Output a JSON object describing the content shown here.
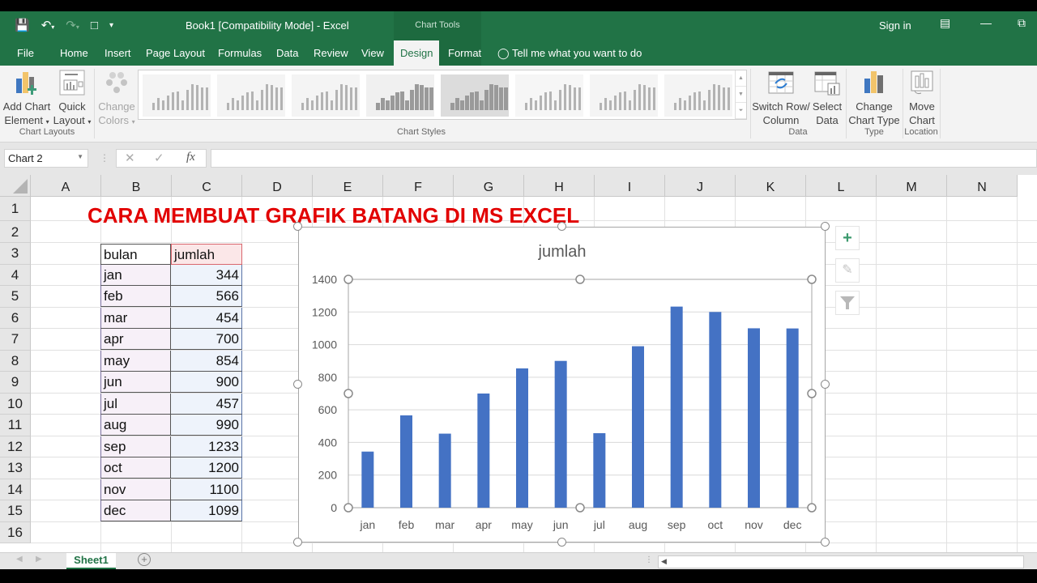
{
  "window": {
    "title": "Book1  [Compatibility Mode]  -  Excel",
    "context_header": "Chart Tools",
    "sign_in": "Sign in"
  },
  "qat": {
    "save_icon": "save-icon",
    "undo_icon": "undo-icon",
    "redo_icon": "redo-icon",
    "new_icon": "new-document-icon",
    "customize_icon": "customize-qat-icon"
  },
  "tabs": [
    {
      "label": "File"
    },
    {
      "label": "Home"
    },
    {
      "label": "Insert"
    },
    {
      "label": "Page Layout"
    },
    {
      "label": "Formulas"
    },
    {
      "label": "Data"
    },
    {
      "label": "Review"
    },
    {
      "label": "View"
    },
    {
      "label": "Design",
      "active": true
    },
    {
      "label": "Format"
    }
  ],
  "tell_me": "Tell me what you want to do",
  "ribbon": {
    "add_chart_element": [
      "Add Chart",
      "Element"
    ],
    "quick_layout": [
      "Quick",
      "Layout"
    ],
    "change_colors": [
      "Change",
      "Colors"
    ],
    "chart_layouts_label": "Chart Layouts",
    "chart_styles_label": "Chart Styles",
    "switch_row_col": [
      "Switch Row/",
      "Column"
    ],
    "select_data": [
      "Select",
      "Data"
    ],
    "data_label": "Data",
    "change_chart_type": [
      "Change",
      "Chart Type"
    ],
    "type_label": "Type",
    "move_chart": [
      "Move",
      "Chart"
    ],
    "location_label": "Location"
  },
  "formula_bar": {
    "name_box": "Chart 2",
    "cancel": "✕",
    "enter": "✓",
    "fx": "fx",
    "value": ""
  },
  "columns": [
    "A",
    "B",
    "C",
    "D",
    "E",
    "F",
    "G",
    "H",
    "I",
    "J",
    "K",
    "L",
    "M",
    "N"
  ],
  "rows": [
    "1",
    "2",
    "3",
    "4",
    "5",
    "6",
    "7",
    "8",
    "9",
    "10",
    "11",
    "12",
    "13",
    "14",
    "15",
    "16"
  ],
  "sheet": {
    "title": "CARA MEMBUAT GRAFIK BATANG DI MS EXCEL",
    "headers": {
      "bulan": "bulan",
      "jumlah": "jumlah"
    },
    "table": [
      {
        "bulan": "jan",
        "jumlah": "344"
      },
      {
        "bulan": "feb",
        "jumlah": "566"
      },
      {
        "bulan": "mar",
        "jumlah": "454"
      },
      {
        "bulan": "apr",
        "jumlah": "700"
      },
      {
        "bulan": "may",
        "jumlah": "854"
      },
      {
        "bulan": "jun",
        "jumlah": "900"
      },
      {
        "bulan": "jul",
        "jumlah": "457"
      },
      {
        "bulan": "aug",
        "jumlah": "990"
      },
      {
        "bulan": "sep",
        "jumlah": "1233"
      },
      {
        "bulan": "oct",
        "jumlah": "1200"
      },
      {
        "bulan": "nov",
        "jumlah": "1100"
      },
      {
        "bulan": "dec",
        "jumlah": "1099"
      }
    ]
  },
  "chart_data": {
    "type": "bar",
    "title": "jumlah",
    "categories": [
      "jan",
      "feb",
      "mar",
      "apr",
      "may",
      "jun",
      "jul",
      "aug",
      "sep",
      "oct",
      "nov",
      "dec"
    ],
    "values": [
      344,
      566,
      454,
      700,
      854,
      900,
      457,
      990,
      1233,
      1200,
      1100,
      1099
    ],
    "xlabel": "",
    "ylabel": "",
    "ylim": [
      0,
      1400
    ],
    "yticks": [
      0,
      200,
      400,
      600,
      800,
      1000,
      1200,
      1400
    ],
    "grid": true,
    "legend": "none",
    "bar_color": "#4472c4"
  },
  "chart_side_buttons": {
    "elements": "+",
    "styles_icon": "paintbrush-icon",
    "filter_icon": "filter-icon"
  },
  "sheet_tabs": [
    {
      "label": "Sheet1",
      "active": true
    }
  ],
  "colors": {
    "excel_green": "#217346",
    "title_red": "#e20000"
  }
}
